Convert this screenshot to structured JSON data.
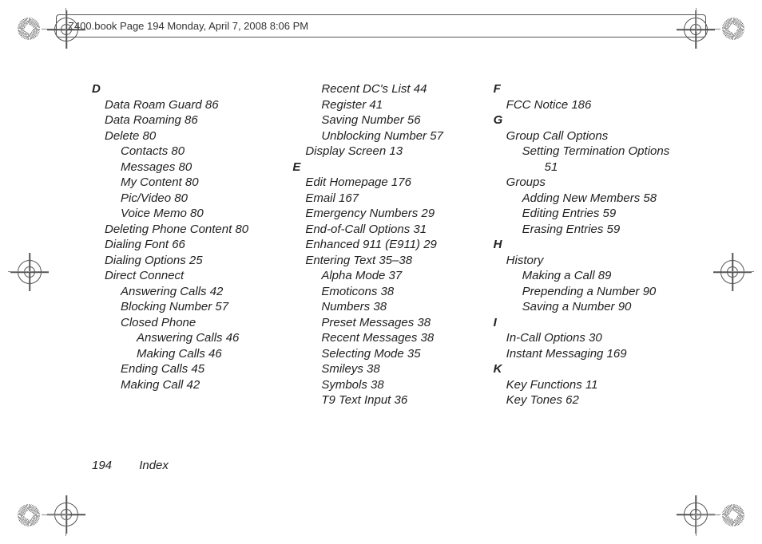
{
  "header": {
    "file_info": "Z400.book  Page 194  Monday, April 7, 2008  8:06 PM"
  },
  "footer": {
    "page_num": "194",
    "section": "Index"
  },
  "col1": {
    "D_letter": "D",
    "data_roam_guard": "Data Roam Guard 86",
    "data_roaming": "Data Roaming 86",
    "delete": "Delete 80",
    "delete_contacts": "Contacts 80",
    "delete_messages": "Messages 80",
    "delete_my_content": "My Content 80",
    "delete_picvideo": "Pic/Video 80",
    "delete_voice_memo": "Voice Memo 80",
    "deleting_phone_content": "Deleting Phone Content 80",
    "dialing_font": "Dialing Font 66",
    "dialing_options": "Dialing Options 25",
    "direct_connect": "Direct Connect",
    "dc_answering": "Answering Calls 42",
    "dc_blocking": "Blocking Number 57",
    "dc_closed_phone": "Closed Phone",
    "dc_cp_answering": "Answering Calls 46",
    "dc_cp_making": "Making Calls 46",
    "dc_ending": "Ending Calls 45",
    "dc_making": "Making Call 42"
  },
  "col2": {
    "recent_dcs": "Recent DC's List 44",
    "register": "Register 41",
    "saving_number": "Saving Number 56",
    "unblocking": "Unblocking Number 57",
    "display_screen": "Display Screen 13",
    "E_letter": "E",
    "edit_homepage": "Edit Homepage 176",
    "email": "Email 167",
    "emergency_numbers": "Emergency Numbers 29",
    "eoc_options": "End-of-Call Options 31",
    "enhanced_911": "Enhanced 911 (E911) 29",
    "entering_text": "Entering Text 35–38",
    "et_alpha": "Alpha Mode 37",
    "et_emoticons": "Emoticons 38",
    "et_numbers": "Numbers 38",
    "et_preset": "Preset Messages 38",
    "et_recent": "Recent Messages 38",
    "et_selecting": "Selecting Mode 35",
    "et_smileys": "Smileys 38",
    "et_symbols": "Symbols 38",
    "et_t9": "T9 Text Input 36"
  },
  "col3": {
    "F_letter": "F",
    "fcc": "FCC Notice 186",
    "G_letter": "G",
    "group_call_options": "Group Call Options",
    "gco_setting": "Setting Termination Options",
    "gco_setting_page": "51",
    "groups": "Groups",
    "groups_adding": "Adding New Members 58",
    "groups_editing": "Editing Entries 59",
    "groups_erasing": "Erasing Entries 59",
    "H_letter": "H",
    "history": "History",
    "history_making": "Making a Call 89",
    "history_prepending": "Prepending a Number 90",
    "history_saving": "Saving a Number 90",
    "I_letter": "I",
    "incall": "In-Call Options 30",
    "im": "Instant Messaging 169",
    "K_letter": "K",
    "key_functions": "Key Functions 11",
    "key_tones": "Key Tones 62"
  }
}
